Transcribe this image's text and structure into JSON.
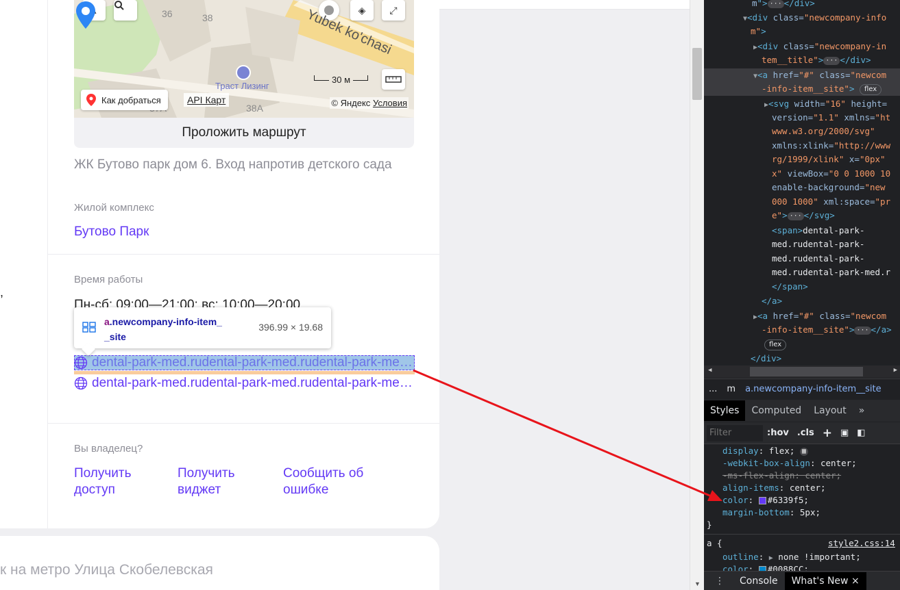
{
  "map": {
    "labels": [
      "38",
      "36",
      "38А",
      "37А"
    ],
    "street": "Yubek ko'chasi",
    "poi": "Траст Лизинг",
    "directions_label": "Как добраться",
    "api_label": "API Карт",
    "copyright": "© Яндекс",
    "terms": "Условия",
    "scale": "30 м"
  },
  "route_button": "Проложить маршрут",
  "address_note": "ЖК Бутово парк дом 6. Вход напротив детского сада",
  "complex": {
    "label": "Жилой комплекс",
    "value": "Бутово Парк"
  },
  "hours": {
    "label": "Время работы",
    "value": "Пн-сб: 09:00—21:00; вс: 10:00—20:00"
  },
  "tooltip": {
    "tag": "a",
    "class_part1": ".newcompany-info-item_",
    "class_part2": "_site",
    "size": "396.99 × 19.68"
  },
  "sites": [
    "dental-park-med.rudental-park-med.rudental-park-med.rudental-park-med.ru",
    "dental-park-med.rudental-park-med.rudental-park-med.rudental-park-med.ru"
  ],
  "owner": {
    "label": "Вы владелец?",
    "links": [
      {
        "line1": "Получить",
        "line2": "доступ"
      },
      {
        "line1": "Получить",
        "line2": "виджет"
      },
      {
        "line1": "Сообщить об",
        "line2": "ошибке"
      }
    ]
  },
  "metro": "к на метро Улица Скобелевская",
  "devtools": {
    "crumbs": [
      "...",
      "m",
      "a.newcompany-info-item__site"
    ],
    "tabs": [
      "Styles",
      "Computed",
      "Layout",
      "»"
    ],
    "filter_placeholder": "Filter",
    "hov": ":hov",
    "cls": ".cls",
    "plus": "+",
    "drawer_tabs": [
      "Console",
      "What's New"
    ],
    "close": "×",
    "source": "style2.css:14",
    "rule2_selector": "a {",
    "color_value": "#6339f5",
    "color2_value": "#0088CC;"
  },
  "colors": {
    "accent": "#6339f5",
    "arrow": "#e8141b",
    "tooltip_tag": "#881280"
  }
}
